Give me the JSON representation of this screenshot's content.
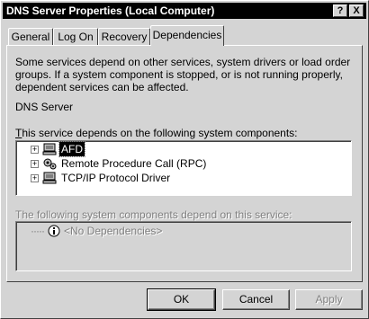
{
  "window": {
    "title": "DNS Server Properties (Local Computer)",
    "help_button": "?",
    "close_button": "X"
  },
  "tabs": [
    {
      "label": "General"
    },
    {
      "label": "Log On"
    },
    {
      "label": "Recovery"
    },
    {
      "label": "Dependencies",
      "active": true
    }
  ],
  "dependencies": {
    "description": "Some services depend on other services, system drivers or load order groups. If a system component is stopped, or is not running properly, dependent services can be affected.",
    "service_name": "DNS Server",
    "depends_on_label": "This service depends on the following system components:",
    "depends_on_items": [
      {
        "label": "AFD",
        "icon": "driver-icon",
        "selected": true
      },
      {
        "label": "Remote Procedure Call (RPC)",
        "icon": "service-gears-icon",
        "selected": false
      },
      {
        "label": "TCP/IP Protocol Driver",
        "icon": "driver-icon",
        "selected": false
      }
    ],
    "dependents_label": "The following system components depend on this service:",
    "dependents_items": [
      {
        "label": "<No Dependencies>",
        "icon": "info-icon"
      }
    ]
  },
  "buttons": {
    "ok": "OK",
    "cancel": "Cancel",
    "apply": "Apply"
  },
  "colors": {
    "titlebar": "#000000",
    "face": "#d4d4d4",
    "selection": "#000000"
  }
}
